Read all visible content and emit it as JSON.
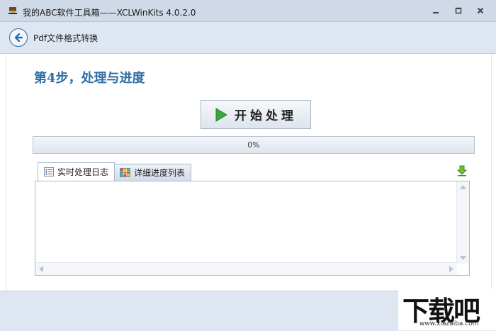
{
  "window": {
    "title": "我的ABC软件工具箱——XCLWinKits  4.0.2.0",
    "icons": {
      "app": "app-icon",
      "minimize": "minimize-icon",
      "maximize": "maximize-icon",
      "close": "close-icon"
    }
  },
  "nav": {
    "back_icon": "back-arrow-icon",
    "title": "Pdf文件格式转换"
  },
  "step": {
    "title": "第4步，处理与进度"
  },
  "start_button": {
    "label": "开始处理",
    "icon": "play-icon"
  },
  "progress": {
    "percent": 0,
    "label": "0%"
  },
  "tabs": [
    {
      "label": "实时处理日志",
      "icon": "list-icon",
      "active": true
    },
    {
      "label": "详细进度列表",
      "icon": "grid-icon",
      "active": false
    }
  ],
  "export_icon": "download-icon",
  "watermark": {
    "text": "下载吧",
    "url": "www.xiazaiba.com"
  },
  "colors": {
    "accent": "#2f6ea6",
    "play": "#3aa83a",
    "titlebar": "#cfd9e8"
  }
}
